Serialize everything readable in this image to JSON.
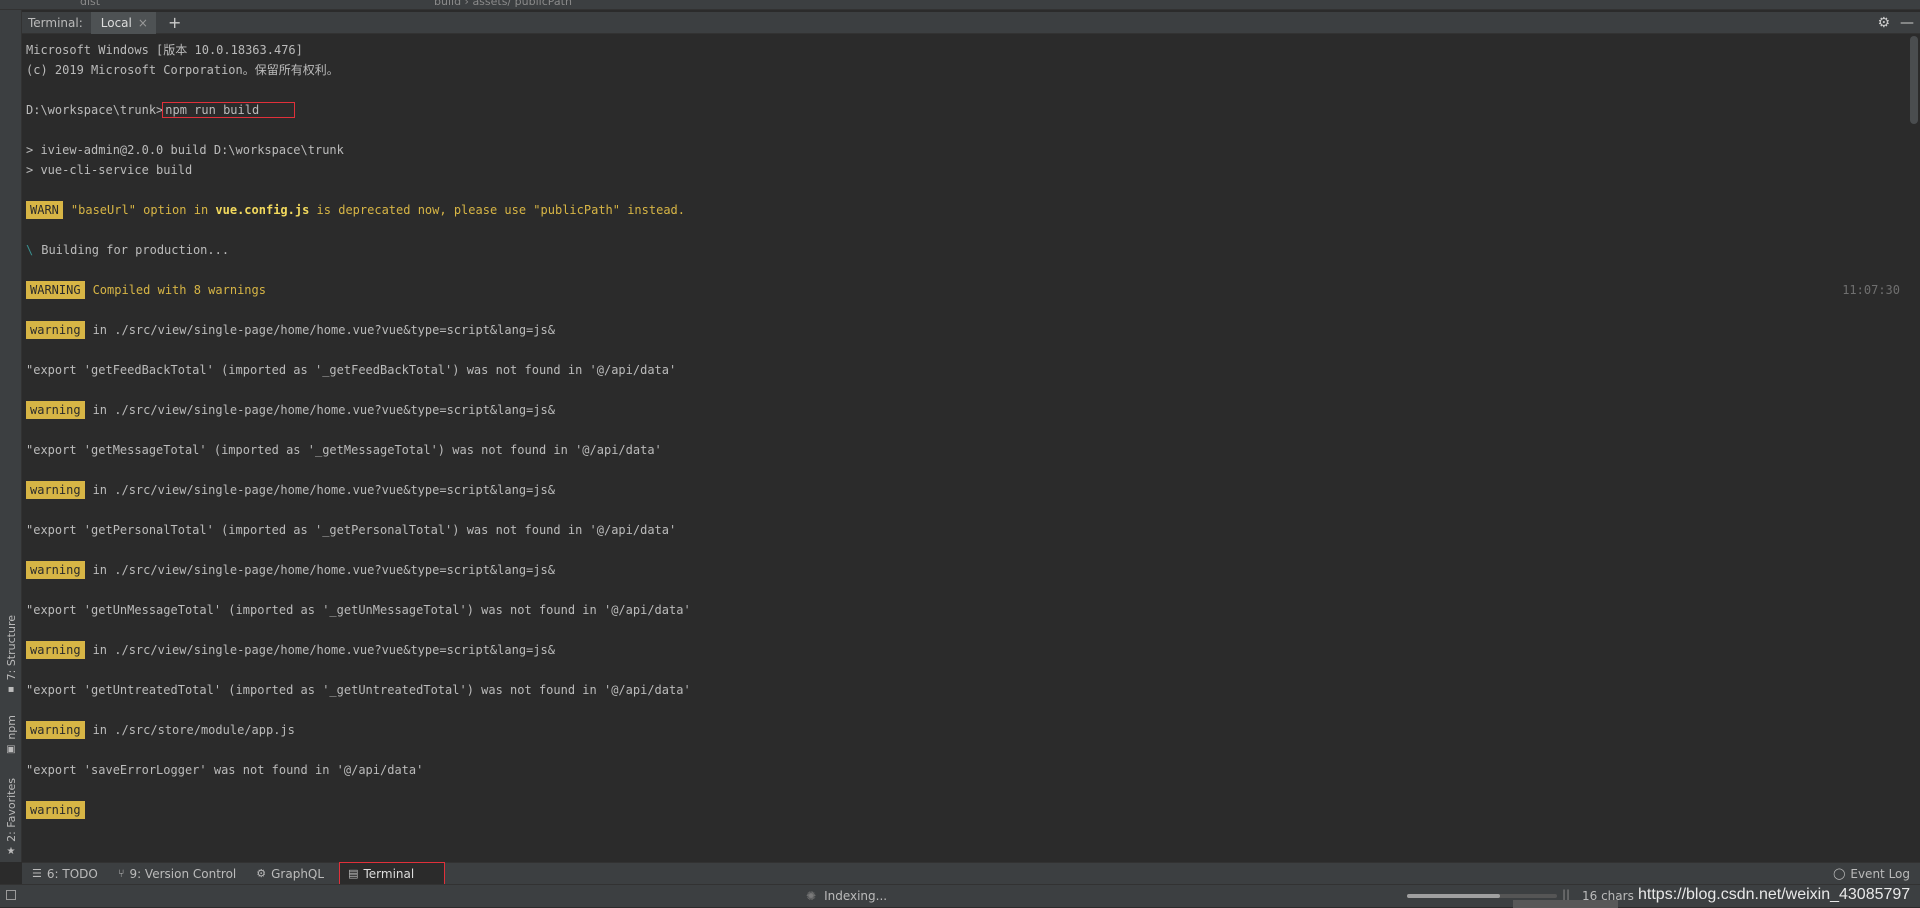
{
  "top_strip": {
    "left_crumb": "dist",
    "right_crumb": "build  ›  assets/ publicPath"
  },
  "terminal_header": {
    "label": "Terminal:",
    "tab": "Local",
    "close_glyph": "×",
    "add_glyph": "+",
    "gear_glyph": "⚙",
    "minimize_glyph": "—"
  },
  "left_strip": {
    "structure": "7: Structure",
    "npm": "npm",
    "favorites": "2: Favorites"
  },
  "terminal": {
    "lines": {
      "l1": "Microsoft Windows [版本 10.0.18363.476]",
      "l2": "(c) 2019 Microsoft Corporation。保留所有权利。",
      "prompt": "D:\\workspace\\trunk>",
      "command": "npm run build",
      "l4": "> iview-admin@2.0.0 build D:\\workspace\\trunk",
      "l5": "> vue-cli-service build",
      "warn_badge": "WARN",
      "warn_part1": "\"baseUrl\" option in ",
      "warn_file": "vue.config.js",
      "warn_part2": " is deprecated now, please use \"publicPath\" instead.",
      "spinner": "\\",
      "building": "Building for production...",
      "warning_caps_badge": "WARNING",
      "compiled": "Compiled with 8 warnings",
      "timestamp": "11:07:30",
      "warning_badge": "warning",
      "in_home": "in ./src/view/single-page/home/home.vue?vue&type=script&lang=js&",
      "export1": "\"export 'getFeedBackTotal' (imported as '_getFeedBackTotal') was not found in '@/api/data'",
      "export2": "\"export 'getMessageTotal' (imported as '_getMessageTotal') was not found in '@/api/data'",
      "export3": "\"export 'getPersonalTotal' (imported as '_getPersonalTotal') was not found in '@/api/data'",
      "export4": "\"export 'getUnMessageTotal' (imported as '_getUnMessageTotal') was not found in '@/api/data'",
      "export5": "\"export 'getUntreatedTotal' (imported as '_getUntreatedTotal') was not found in '@/api/data'",
      "in_app": "in ./src/store/module/app.js",
      "export6": "\"export 'saveErrorLogger' was not found in '@/api/data'"
    }
  },
  "tool_bar": {
    "todo": "6: TODO",
    "version_control": "9: Version Control",
    "graphql": "GraphQL",
    "terminal": "Terminal",
    "event_log": "Event Log"
  },
  "status_bar": {
    "indexing": "Indexing...",
    "progress_fraction": 0.62,
    "chars": "16 chars",
    "watermark": "https://blog.csdn.net/weixin_43085797"
  },
  "colors": {
    "badge": "#d7b545",
    "warn_text": "#d7b545",
    "highlight_box": "#e0303a",
    "background": "#2b2b2b"
  }
}
